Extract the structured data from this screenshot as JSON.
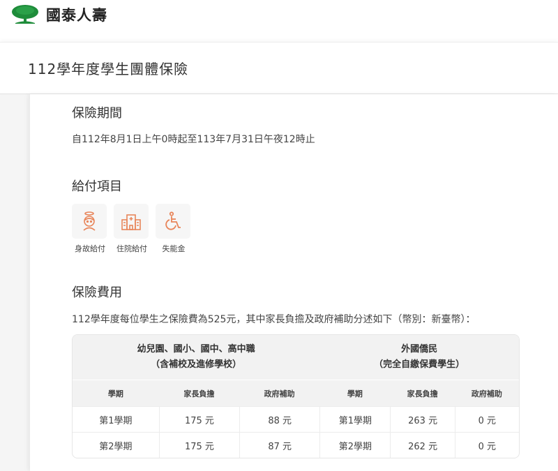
{
  "brand": {
    "name": "國泰人壽",
    "accent": "#1e8c3a"
  },
  "page": {
    "title": "112學年度學生團體保險"
  },
  "period": {
    "title": "保險期間",
    "text": "自112年8月1日上午0時起至113年7月31日午夜12時止"
  },
  "benefits": {
    "title": "給付項目",
    "items": [
      {
        "label": "身故給付",
        "icon": "angel-icon"
      },
      {
        "label": "住院給付",
        "icon": "hospital-icon"
      },
      {
        "label": "失能金",
        "icon": "wheelchair-icon"
      }
    ],
    "icon_color": "#e8855a"
  },
  "fees": {
    "title": "保險費用",
    "text": "112學年度每位學生之保險費為525元，其中家長負擔及政府補助分述如下（幣別：新臺幣）：",
    "groups": [
      {
        "line1": "幼兒園、國小、國中、高中職",
        "line2": "（含補校及進修學校）"
      },
      {
        "line1": "外國僑民",
        "line2": "（完全自繳保費學生）"
      }
    ],
    "columns": [
      "學期",
      "家長負擔",
      "政府補助",
      "學期",
      "家長負擔",
      "政府補助"
    ],
    "rows": [
      [
        "第1學期",
        "175 元",
        "88 元",
        "第1學期",
        "263 元",
        "0 元"
      ],
      [
        "第2學期",
        "175 元",
        "87 元",
        "第2學期",
        "262 元",
        "0 元"
      ]
    ]
  }
}
